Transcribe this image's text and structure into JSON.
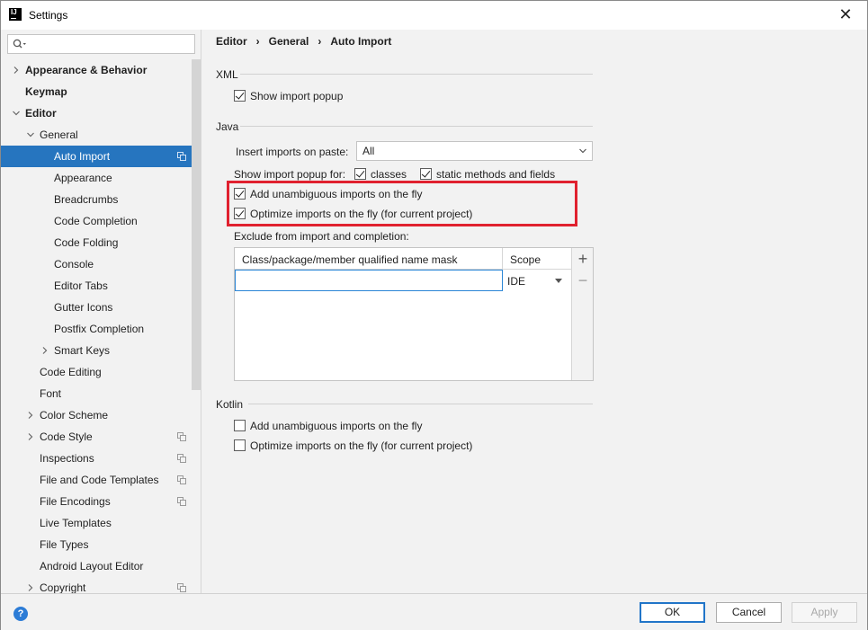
{
  "window": {
    "title": "Settings"
  },
  "search": {
    "placeholder": ""
  },
  "sidebar": {
    "items": [
      {
        "label": "Appearance & Behavior",
        "level": 0,
        "bold": true,
        "chevron": "right",
        "selected": false,
        "copy_icon": false
      },
      {
        "label": "Keymap",
        "level": 0,
        "bold": true,
        "chevron": "none",
        "selected": false,
        "copy_icon": false
      },
      {
        "label": "Editor",
        "level": 0,
        "bold": true,
        "chevron": "down",
        "selected": false,
        "copy_icon": false
      },
      {
        "label": "General",
        "level": 1,
        "bold": false,
        "chevron": "down",
        "selected": false,
        "copy_icon": false
      },
      {
        "label": "Auto Import",
        "level": 2,
        "bold": false,
        "chevron": "none",
        "selected": true,
        "copy_icon": true
      },
      {
        "label": "Appearance",
        "level": 2,
        "bold": false,
        "chevron": "none",
        "selected": false,
        "copy_icon": false
      },
      {
        "label": "Breadcrumbs",
        "level": 2,
        "bold": false,
        "chevron": "none",
        "selected": false,
        "copy_icon": false
      },
      {
        "label": "Code Completion",
        "level": 2,
        "bold": false,
        "chevron": "none",
        "selected": false,
        "copy_icon": false
      },
      {
        "label": "Code Folding",
        "level": 2,
        "bold": false,
        "chevron": "none",
        "selected": false,
        "copy_icon": false
      },
      {
        "label": "Console",
        "level": 2,
        "bold": false,
        "chevron": "none",
        "selected": false,
        "copy_icon": false
      },
      {
        "label": "Editor Tabs",
        "level": 2,
        "bold": false,
        "chevron": "none",
        "selected": false,
        "copy_icon": false
      },
      {
        "label": "Gutter Icons",
        "level": 2,
        "bold": false,
        "chevron": "none",
        "selected": false,
        "copy_icon": false
      },
      {
        "label": "Postfix Completion",
        "level": 2,
        "bold": false,
        "chevron": "none",
        "selected": false,
        "copy_icon": false
      },
      {
        "label": "Smart Keys",
        "level": 2,
        "bold": false,
        "chevron": "right",
        "selected": false,
        "copy_icon": false
      },
      {
        "label": "Code Editing",
        "level": 1,
        "bold": false,
        "chevron": "none",
        "selected": false,
        "copy_icon": false
      },
      {
        "label": "Font",
        "level": 1,
        "bold": false,
        "chevron": "none",
        "selected": false,
        "copy_icon": false
      },
      {
        "label": "Color Scheme",
        "level": 1,
        "bold": false,
        "chevron": "right",
        "selected": false,
        "copy_icon": false
      },
      {
        "label": "Code Style",
        "level": 1,
        "bold": false,
        "chevron": "right",
        "selected": false,
        "copy_icon": true
      },
      {
        "label": "Inspections",
        "level": 1,
        "bold": false,
        "chevron": "none",
        "selected": false,
        "copy_icon": true
      },
      {
        "label": "File and Code Templates",
        "level": 1,
        "bold": false,
        "chevron": "none",
        "selected": false,
        "copy_icon": true
      },
      {
        "label": "File Encodings",
        "level": 1,
        "bold": false,
        "chevron": "none",
        "selected": false,
        "copy_icon": true
      },
      {
        "label": "Live Templates",
        "level": 1,
        "bold": false,
        "chevron": "none",
        "selected": false,
        "copy_icon": false
      },
      {
        "label": "File Types",
        "level": 1,
        "bold": false,
        "chevron": "none",
        "selected": false,
        "copy_icon": false
      },
      {
        "label": "Android Layout Editor",
        "level": 1,
        "bold": false,
        "chevron": "none",
        "selected": false,
        "copy_icon": false
      },
      {
        "label": "Copyright",
        "level": 1,
        "bold": false,
        "chevron": "right",
        "selected": false,
        "copy_icon": true
      }
    ]
  },
  "breadcrumb": {
    "items": [
      "Editor",
      "General",
      "Auto Import"
    ],
    "separator": "›"
  },
  "xml": {
    "heading": "XML",
    "show_import_popup": {
      "label": "Show import popup",
      "checked": true
    }
  },
  "java": {
    "heading": "Java",
    "insert_imports_label": "Insert imports on paste:",
    "insert_imports_value": "All",
    "show_popup_for_label": "Show import popup for:",
    "classes": {
      "label": "classes",
      "checked": true
    },
    "static_methods": {
      "label": "static methods and fields",
      "checked": true
    },
    "add_unambiguous": {
      "label": "Add unambiguous imports on the fly",
      "checked": true
    },
    "optimize_imports": {
      "label": "Optimize imports on the fly (for current project)",
      "checked": true
    },
    "exclude_label": "Exclude from import and completion:",
    "table": {
      "columns": [
        "Class/package/member qualified name mask",
        "Scope"
      ],
      "rows": [
        {
          "mask": "",
          "scope": "IDE"
        }
      ]
    }
  },
  "kotlin": {
    "heading": "Kotlin",
    "add_unambiguous": {
      "label": "Add unambiguous imports on the fly",
      "checked": false
    },
    "optimize_imports": {
      "label": "Optimize imports on the fly (for current project)",
      "checked": false
    }
  },
  "buttons": {
    "ok": "OK",
    "cancel": "Cancel",
    "apply": "Apply",
    "help": "?"
  },
  "colors": {
    "selection": "#2675bf",
    "highlight_box": "#e0212f",
    "accent": "#2175c8"
  }
}
